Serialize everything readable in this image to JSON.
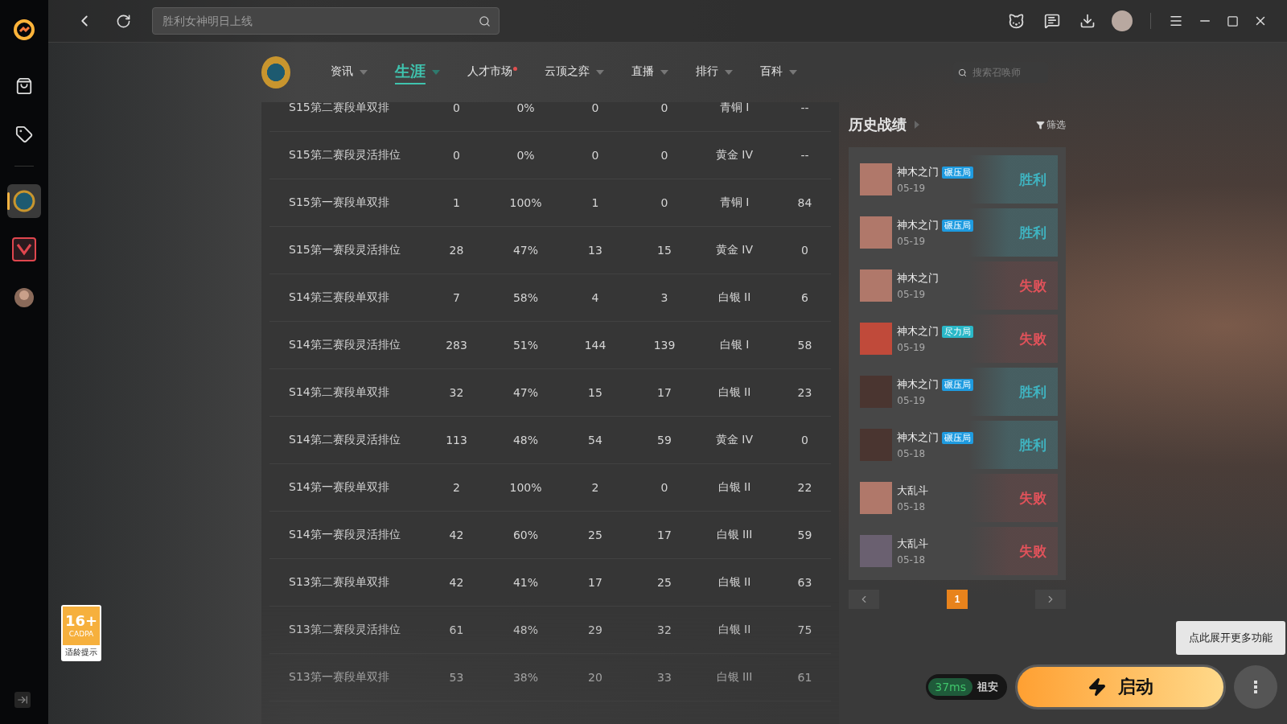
{
  "search": {
    "placeholder": "胜利女神明日上线"
  },
  "sidebar": {
    "items": [
      {
        "kind": "store",
        "selected": false
      },
      {
        "kind": "tag",
        "selected": false
      },
      {
        "kind": "lol",
        "selected": true
      },
      {
        "kind": "valorant",
        "selected": false
      },
      {
        "kind": "other",
        "selected": false
      }
    ]
  },
  "nav": {
    "items": [
      {
        "label": "资讯",
        "selected": false,
        "dropdown": true,
        "dot": false
      },
      {
        "label": "生涯",
        "selected": true,
        "dropdown": true,
        "dot": false
      },
      {
        "label": "人才市场",
        "selected": false,
        "dropdown": false,
        "dot": true
      },
      {
        "label": "云顶之弈",
        "selected": false,
        "dropdown": true,
        "dot": false
      },
      {
        "label": "直播",
        "selected": false,
        "dropdown": true,
        "dot": false
      },
      {
        "label": "排行",
        "selected": false,
        "dropdown": true,
        "dot": false
      },
      {
        "label": "百科",
        "selected": false,
        "dropdown": true,
        "dot": false
      }
    ],
    "summoner_search": {
      "placeholder": "搜索召唤师"
    }
  },
  "table": {
    "rows": [
      {
        "cells": [
          "S15第二赛段单双排",
          "0",
          "0%",
          "0",
          "0",
          "青铜 I",
          "--"
        ]
      },
      {
        "cells": [
          "S15第二赛段灵活排位",
          "0",
          "0%",
          "0",
          "0",
          "黄金 IV",
          "--"
        ]
      },
      {
        "cells": [
          "S15第一赛段单双排",
          "1",
          "100%",
          "1",
          "0",
          "青铜 I",
          "84"
        ]
      },
      {
        "cells": [
          "S15第一赛段灵活排位",
          "28",
          "47%",
          "13",
          "15",
          "黄金 IV",
          "0"
        ]
      },
      {
        "cells": [
          "S14第三赛段单双排",
          "7",
          "58%",
          "4",
          "3",
          "白银 II",
          "6"
        ]
      },
      {
        "cells": [
          "S14第三赛段灵活排位",
          "283",
          "51%",
          "144",
          "139",
          "白银 I",
          "58"
        ]
      },
      {
        "cells": [
          "S14第二赛段单双排",
          "32",
          "47%",
          "15",
          "17",
          "白银 II",
          "23"
        ]
      },
      {
        "cells": [
          "S14第二赛段灵活排位",
          "113",
          "48%",
          "54",
          "59",
          "黄金 IV",
          "0"
        ]
      },
      {
        "cells": [
          "S14第一赛段单双排",
          "2",
          "100%",
          "2",
          "0",
          "白银 II",
          "22"
        ]
      },
      {
        "cells": [
          "S14第一赛段灵活排位",
          "42",
          "60%",
          "25",
          "17",
          "白银 III",
          "59"
        ]
      },
      {
        "cells": [
          "S13第二赛段单双排",
          "42",
          "41%",
          "17",
          "25",
          "白银 II",
          "63"
        ]
      },
      {
        "cells": [
          "S13第二赛段灵活排位",
          "61",
          "48%",
          "29",
          "32",
          "白银 II",
          "75"
        ]
      },
      {
        "cells": [
          "S13第一赛段单双排",
          "53",
          "38%",
          "20",
          "33",
          "白银 III",
          "61"
        ]
      }
    ]
  },
  "history": {
    "title": "历史战绩",
    "filter": "筛选",
    "matches": [
      {
        "mode": "神木之门",
        "tag": {
          "label": "碾压局",
          "color": "#1e9be0"
        },
        "date": "05-19",
        "kind": "win",
        "result": "胜利"
      },
      {
        "mode": "神木之门",
        "tag": {
          "label": "碾压局",
          "color": "#1e9be0"
        },
        "date": "05-19",
        "kind": "win",
        "result": "胜利"
      },
      {
        "mode": "神木之门",
        "date": "05-19",
        "kind": "loss",
        "result": "失败"
      },
      {
        "mode": "神木之门",
        "tag": {
          "label": "尽力局",
          "color": "#2ab8c8"
        },
        "date": "05-19",
        "kind": "loss",
        "result": "失败"
      },
      {
        "mode": "神木之门",
        "tag": {
          "label": "碾压局",
          "color": "#1e9be0"
        },
        "date": "05-19",
        "kind": "win",
        "result": "胜利"
      },
      {
        "mode": "神木之门",
        "tag": {
          "label": "碾压局",
          "color": "#1e9be0"
        },
        "date": "05-18",
        "kind": "win",
        "result": "胜利"
      },
      {
        "mode": "大乱斗",
        "date": "05-18",
        "kind": "loss",
        "result": "失败"
      },
      {
        "mode": "大乱斗",
        "date": "05-18",
        "kind": "loss",
        "result": "失败"
      }
    ],
    "pages": [
      {
        "label": "1",
        "selected": true
      }
    ]
  },
  "age_badge": {
    "rating": "16+",
    "org": "CADPA",
    "caption": "适龄提示"
  },
  "launch": {
    "ping": "37ms",
    "region": "祖安",
    "button": "启动",
    "tooltip": "点此展开更多功能"
  }
}
